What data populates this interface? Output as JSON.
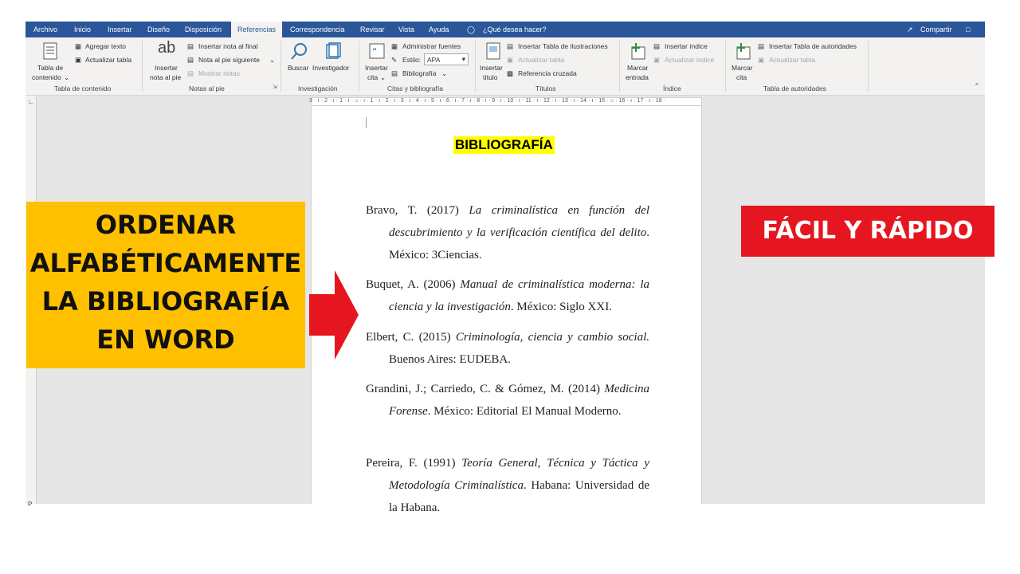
{
  "tabs": [
    "Archivo",
    "Inicio",
    "Insertar",
    "Diseño",
    "Disposición",
    "Referencias",
    "Correspondencia",
    "Revisar",
    "Vista",
    "Ayuda"
  ],
  "tell_me": "¿Qué desea hacer?",
  "share": "Compartir",
  "ribbon": {
    "toc": {
      "button_line1": "Tabla de",
      "button_line2": "contenido",
      "add_text": "Agregar texto",
      "update_table": "Actualizar tabla",
      "group": "Tabla de contenido"
    },
    "footnotes": {
      "insert_line1": "Insertar",
      "insert_line2": "nota al pie",
      "endnote": "Insertar nota al final",
      "next": "Nota al pie siguiente",
      "show": "Mostrar notas",
      "group": "Notas al pie",
      "ab_icon": "ab"
    },
    "research": {
      "search": "Buscar",
      "researcher": "Investigador",
      "group": "Investigación"
    },
    "citations": {
      "insert_line1": "Insertar",
      "insert_line2": "cita",
      "manage": "Administrar fuentes",
      "style_label": "Estilo:",
      "style_value": "APA",
      "bibliography": "Bibliografía",
      "group": "Citas y bibliografía"
    },
    "captions": {
      "insert_line1": "Insertar",
      "insert_line2": "título",
      "figures": "Insertar Tabla de ilustraciones",
      "update": "Actualizar tabla",
      "crossref": "Referencia cruzada",
      "group": "Títulos"
    },
    "index": {
      "mark_line1": "Marcar",
      "mark_line2": "entrada",
      "insert": "Insertar índice",
      "update": "Actualizar índice",
      "group": "Índice"
    },
    "authorities": {
      "mark_line1": "Marcar",
      "mark_line2": "cita",
      "insert": "Insertar Tabla de autoridades",
      "update": "Actualizar tabla",
      "group": "Tabla de autoridades"
    }
  },
  "ruler_text": "3 · ı · 2 · ı · 1 · ı · ⌂ · ı · 1 · ı · 2 · ı · 3 · ı · 4 · ı · 5 · ı · 6 · ı · 7 · ı · 8 · ı · 9 · ı · 10 · ı · 11 · ı · 12 · ı · 13 · ı · 14 · ı · 15 · ⌂ · 16 · ı · 17 · ı · 18 ·",
  "document": {
    "title": "BIBLIOGRAFÍA",
    "entries": [
      {
        "pre": "Bravo, T. (2017) ",
        "italic": "La criminalística en función del descubrimiento y la verificación científica del delito",
        "post": ". México: 3Ciencias."
      },
      {
        "pre": "Buquet, A. (2006) ",
        "italic": "Manual de criminalística moderna: la ciencia y la investigación",
        "post": ". México: Siglo XXI."
      },
      {
        "pre": "Elbert, C. (2015) ",
        "italic": "Criminología, ciencia y cambio social.",
        "post": " Buenos Aires: EUDEBA."
      },
      {
        "pre": "Grandini, J.; Carriedo, C. & Gómez, M. (2014) ",
        "italic": "Medicina Forense",
        "post": ". México: Editorial El Manual Moderno."
      },
      {
        "pre": "Pereira, F. (1991) ",
        "italic": "Teoría General, Técnica y Táctica y Metodología Criminalística",
        "post": ". Habana:  Universidad de la Habana."
      }
    ]
  },
  "overlay": {
    "left_lines": [
      "ORDENAR",
      "ALFABÉTICAMENTE",
      "LA BIBLIOGRAFÍA",
      "EN WORD"
    ],
    "right_text": "FÁCIL Y RÁPIDO",
    "colors": {
      "left_bg": "#ffc000",
      "right_bg": "#e5161f",
      "arrow": "#e5161f",
      "word_blue": "#2b579a"
    }
  }
}
